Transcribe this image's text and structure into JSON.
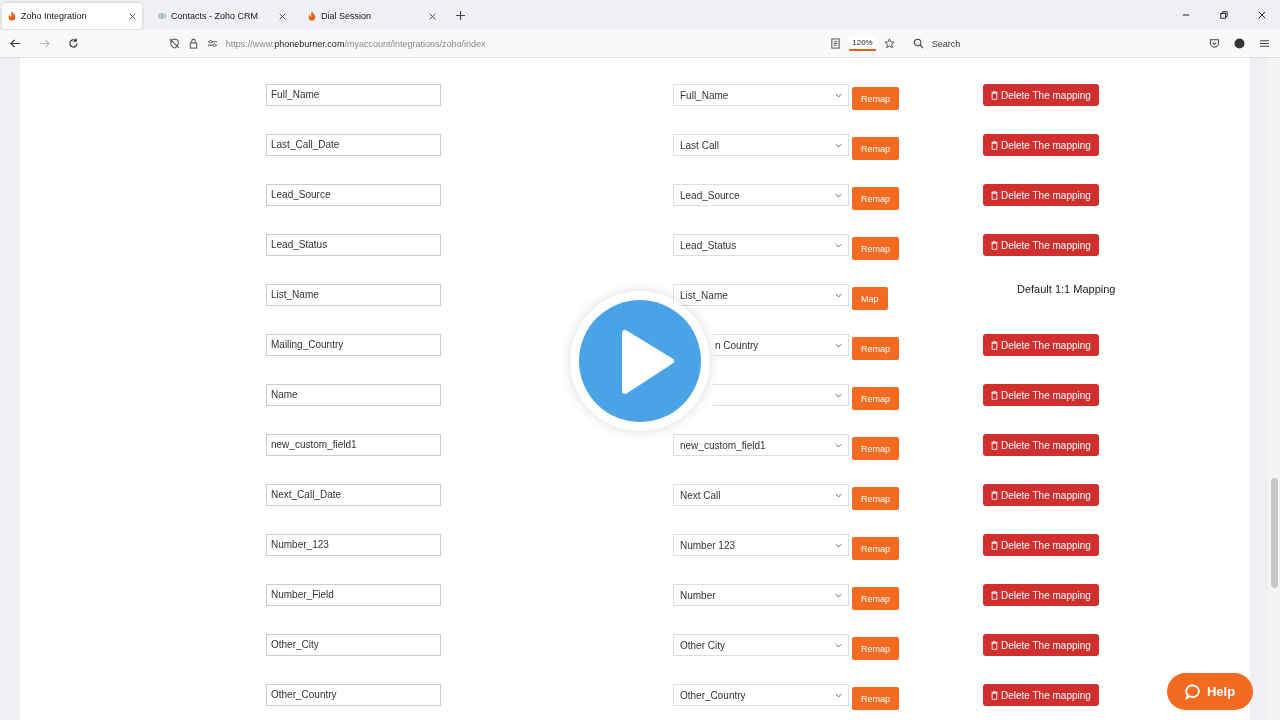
{
  "tabs": [
    {
      "title": "Zoho Integration",
      "selected": true
    },
    {
      "title": "Contacts - Zoho CRM",
      "selected": false
    },
    {
      "title": "Dial Session",
      "selected": false
    }
  ],
  "address_bar": {
    "url_prefix": "https://www.",
    "url_domain": "phoneburner.com",
    "url_path": "/myaccount/integrations/zoho/index"
  },
  "zoom": "120%",
  "search": {
    "placeholder": "Search"
  },
  "mappings": [
    {
      "field": "Full_Name",
      "select": "Full_Name",
      "button": "Remap",
      "kind": "delete",
      "action": "Delete The mapping"
    },
    {
      "field": "Last_Call_Date",
      "select": "Last Call",
      "button": "Remap",
      "kind": "delete",
      "action": "Delete The mapping"
    },
    {
      "field": "Lead_Source",
      "select": "Lead_Source",
      "button": "Remap",
      "kind": "delete",
      "action": "Delete The mapping"
    },
    {
      "field": "Lead_Status",
      "select": "Lead_Status",
      "button": "Remap",
      "kind": "delete",
      "action": "Delete The mapping"
    },
    {
      "field": "List_Name",
      "select": "List_Name",
      "button": "Map",
      "kind": "default",
      "action": "Default 1:1 Mapping"
    },
    {
      "field": "Mailing_Country",
      "select": "n Country",
      "select_partly_hidden": true,
      "button": "Remap",
      "kind": "delete",
      "action": "Delete The mapping"
    },
    {
      "field": "Name",
      "select_partly_hidden": true,
      "button": "Remap",
      "kind": "delete",
      "action": "Delete The mapping"
    },
    {
      "field": "new_custom_field1",
      "select": "new_custom_field1",
      "button": "Remap",
      "kind": "delete",
      "action": "Delete The mapping"
    },
    {
      "field": "Next_Call_Date",
      "select": "Next Call",
      "button": "Remap",
      "kind": "delete",
      "action": "Delete The mapping"
    },
    {
      "field": "Number_123",
      "select": "Number 123",
      "button": "Remap",
      "kind": "delete",
      "action": "Delete The mapping"
    },
    {
      "field": "Number_Field",
      "select": "Number",
      "button": "Remap",
      "kind": "delete",
      "action": "Delete The mapping"
    },
    {
      "field": "Other_City",
      "select": "Other City",
      "button": "Remap",
      "kind": "delete",
      "action": "Delete The mapping"
    },
    {
      "field": "Other_Country",
      "select": "Other_Country",
      "button": "Remap",
      "kind": "delete",
      "action": "Delete The mapping"
    }
  ],
  "help_button": "Help"
}
